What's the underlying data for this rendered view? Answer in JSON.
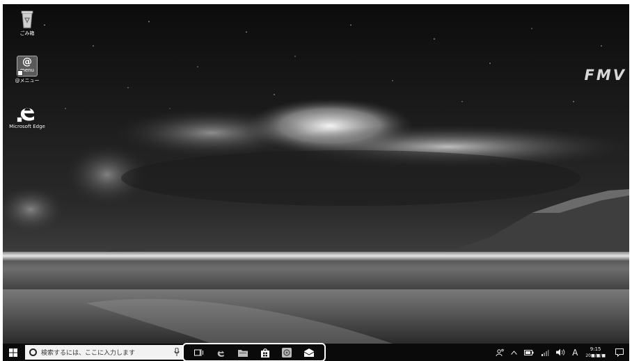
{
  "desktop": {
    "icons": [
      {
        "name": "recycle-bin",
        "label": "ごみ箱"
      },
      {
        "name": "at-menu",
        "label": "@メニュー",
        "icon_text": "@",
        "icon_subtext": "menu"
      },
      {
        "name": "microsoft-edge",
        "label": "Microsoft Edge"
      }
    ],
    "brand": "FMV"
  },
  "taskbar": {
    "search_placeholder": "検索するには、ここに入力します",
    "pinned": [
      "task-view-icon",
      "edge-icon",
      "file-explorer-icon",
      "store-icon",
      "app-icon",
      "mail-icon"
    ],
    "tray": {
      "ime_mode": "A",
      "time": "9:15",
      "date": "20■/■/■"
    }
  }
}
